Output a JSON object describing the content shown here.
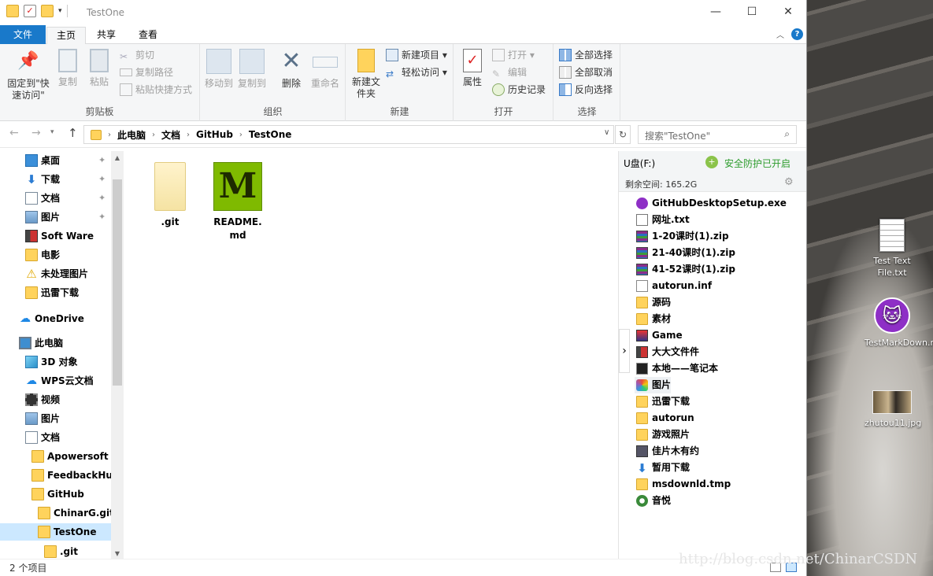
{
  "window": {
    "title": "TestOne"
  },
  "tabs": [
    "文件",
    "主页",
    "共享",
    "查看"
  ],
  "ribbon": {
    "clipboard": {
      "label": "剪贴板",
      "pin": "固定到\"快速访问\"",
      "copy": "复制",
      "paste": "粘贴",
      "cut": "剪切",
      "copy_path": "复制路径",
      "paste_shortcut": "粘贴快捷方式"
    },
    "organize": {
      "label": "组织",
      "move_to": "移动到",
      "copy_to": "复制到",
      "delete": "删除",
      "rename": "重命名"
    },
    "new": {
      "label": "新建",
      "new_folder": "新建文件夹",
      "new_item": "新建项目",
      "easy_access": "轻松访问"
    },
    "open": {
      "label": "打开",
      "properties": "属性",
      "open": "打开",
      "edit": "编辑",
      "history": "历史记录"
    },
    "select": {
      "label": "选择",
      "select_all": "全部选择",
      "select_none": "全部取消",
      "invert": "反向选择"
    }
  },
  "address": {
    "crumbs": [
      "此电脑",
      "文档",
      "GitHub",
      "TestOne"
    ],
    "search_placeholder": "搜索\"TestOne\""
  },
  "nav": {
    "items": [
      {
        "label": "桌面",
        "icon": "desktop-icon",
        "pinned": true
      },
      {
        "label": "下载",
        "icon": "download-icon",
        "pinned": true
      },
      {
        "label": "文档",
        "icon": "document-icon",
        "pinned": true
      },
      {
        "label": "图片",
        "icon": "picture-icon",
        "pinned": true
      },
      {
        "label": "Soft Ware",
        "icon": "app-icon"
      },
      {
        "label": "电影",
        "icon": "folder-icon"
      },
      {
        "label": "未处理图片",
        "icon": "warning-icon"
      },
      {
        "label": "迅雷下载",
        "icon": "folder-icon"
      },
      {
        "label": "OneDrive",
        "icon": "cloud-icon"
      },
      {
        "label": "此电脑",
        "icon": "computer-icon"
      },
      {
        "label": "3D 对象",
        "icon": "cube-icon"
      },
      {
        "label": "WPS云文档",
        "icon": "cloud-icon"
      },
      {
        "label": "视频",
        "icon": "video-icon"
      },
      {
        "label": "图片",
        "icon": "picture-icon"
      },
      {
        "label": "文档",
        "icon": "document-icon"
      },
      {
        "label": "Apowersoft",
        "icon": "folder-icon"
      },
      {
        "label": "FeedbackHul",
        "icon": "folder-icon"
      },
      {
        "label": "GitHub",
        "icon": "folder-icon"
      },
      {
        "label": "ChinarG.git",
        "icon": "folder-icon"
      },
      {
        "label": "TestOne",
        "icon": "folder-icon",
        "selected": true
      },
      {
        "label": ".git",
        "icon": "folder-icon"
      }
    ]
  },
  "files": [
    {
      "name": ".git",
      "icon": "folder-icon"
    },
    {
      "name": "README.md",
      "icon": "markdown-icon"
    }
  ],
  "panel": {
    "drive": "U盘(F:)",
    "protection": "安全防护已开启",
    "free_space": "剩余空间: 165.2G",
    "items": [
      {
        "name": "GitHubDesktopSetup.exe",
        "icon": "github-icon"
      },
      {
        "name": "网址.txt",
        "icon": "text-icon"
      },
      {
        "name": "1-20课时(1).zip",
        "icon": "zip-icon"
      },
      {
        "name": "21-40课时(1).zip",
        "icon": "zip-icon"
      },
      {
        "name": "41-52课时(1).zip",
        "icon": "zip-icon"
      },
      {
        "name": "autorun.inf",
        "icon": "settings-file-icon"
      },
      {
        "name": "源码",
        "icon": "folder-icon"
      },
      {
        "name": "素材",
        "icon": "folder-icon"
      },
      {
        "name": "Game",
        "icon": "game-icon"
      },
      {
        "name": "大大文件件",
        "icon": "app-icon"
      },
      {
        "name": "本地——笔记本",
        "icon": "monitor-icon"
      },
      {
        "name": "图片",
        "icon": "photos-icon"
      },
      {
        "name": "迅雷下载",
        "icon": "folder-icon"
      },
      {
        "name": "autorun",
        "icon": "folder-icon"
      },
      {
        "name": "游戏照片",
        "icon": "folder-icon"
      },
      {
        "name": "佳片木有约",
        "icon": "tool-icon"
      },
      {
        "name": "暂用下载",
        "icon": "download-icon"
      },
      {
        "name": "msdownld.tmp",
        "icon": "folder-icon"
      },
      {
        "name": "音悦",
        "icon": "music-icon"
      }
    ]
  },
  "status": {
    "count": "2 个项目"
  },
  "desktop": {
    "icons": [
      {
        "label": "Test Text File.txt",
        "icon": "text-file-icon"
      },
      {
        "label": "TestMarkDown.md",
        "icon": "github-icon"
      },
      {
        "label": "zhutou11.jpg",
        "icon": "image-file-icon"
      }
    ]
  },
  "watermark": "http://blog.csdn.net/ChinarCSDN",
  "colors": {
    "accent": "#1979ca",
    "selection": "#cce8ff",
    "folder": "#ffd35c",
    "markdown": "#7fba00"
  }
}
